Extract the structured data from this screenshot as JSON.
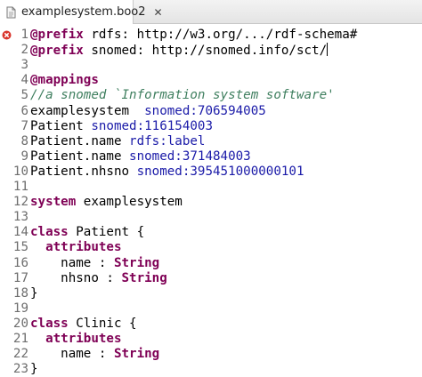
{
  "tab": {
    "title": "examplesystem.boo2",
    "close_glyph": "✕"
  },
  "editor": {
    "lines": [
      {
        "n": "1",
        "marker": "error-icon",
        "tokens": [
          {
            "t": "@prefix",
            "s": "kw"
          },
          {
            "t": " rdfs: http://w3.org/.../rdf-schema#",
            "s": "plain"
          }
        ]
      },
      {
        "n": "2",
        "caret": true,
        "tokens": [
          {
            "t": "@prefix",
            "s": "kw"
          },
          {
            "t": " snomed: http://snomed.info/sct/",
            "s": "plain"
          }
        ]
      },
      {
        "n": "3",
        "tokens": []
      },
      {
        "n": "4",
        "tokens": [
          {
            "t": "@mappings",
            "s": "kw"
          }
        ]
      },
      {
        "n": "5",
        "tokens": [
          {
            "t": "//a snomed `Information system software'",
            "s": "cm"
          }
        ]
      },
      {
        "n": "6",
        "tokens": [
          {
            "t": "examplesystem  ",
            "s": "plain"
          },
          {
            "t": "snomed:706594005",
            "s": "uri"
          }
        ]
      },
      {
        "n": "7",
        "tokens": [
          {
            "t": "Patient ",
            "s": "plain"
          },
          {
            "t": "snomed:116154003",
            "s": "uri"
          }
        ]
      },
      {
        "n": "8",
        "tokens": [
          {
            "t": "Patient.name ",
            "s": "plain"
          },
          {
            "t": "rdfs:label",
            "s": "uri"
          }
        ]
      },
      {
        "n": "9",
        "tokens": [
          {
            "t": "Patient.name ",
            "s": "plain"
          },
          {
            "t": "snomed:371484003",
            "s": "uri"
          }
        ]
      },
      {
        "n": "10",
        "tokens": [
          {
            "t": "Patient.nhsno ",
            "s": "plain"
          },
          {
            "t": "snomed:395451000000101",
            "s": "uri"
          }
        ]
      },
      {
        "n": "11",
        "tokens": []
      },
      {
        "n": "12",
        "tokens": [
          {
            "t": "system",
            "s": "kw"
          },
          {
            "t": " examplesystem",
            "s": "plain"
          }
        ]
      },
      {
        "n": "13",
        "tokens": []
      },
      {
        "n": "14",
        "tokens": [
          {
            "t": "class",
            "s": "kw"
          },
          {
            "t": " Patient {",
            "s": "plain"
          }
        ]
      },
      {
        "n": "15",
        "tokens": [
          {
            "t": "  ",
            "s": "plain"
          },
          {
            "t": "attributes",
            "s": "kw"
          }
        ]
      },
      {
        "n": "16",
        "tokens": [
          {
            "t": "    name : ",
            "s": "plain"
          },
          {
            "t": "String",
            "s": "kw"
          }
        ]
      },
      {
        "n": "17",
        "tokens": [
          {
            "t": "    nhsno : ",
            "s": "plain"
          },
          {
            "t": "String",
            "s": "kw"
          }
        ]
      },
      {
        "n": "18",
        "tokens": [
          {
            "t": "}",
            "s": "plain"
          }
        ]
      },
      {
        "n": "19",
        "tokens": []
      },
      {
        "n": "20",
        "tokens": [
          {
            "t": "class",
            "s": "kw"
          },
          {
            "t": " Clinic {",
            "s": "plain"
          }
        ]
      },
      {
        "n": "21",
        "tokens": [
          {
            "t": "  ",
            "s": "plain"
          },
          {
            "t": "attributes",
            "s": "kw"
          }
        ]
      },
      {
        "n": "22",
        "tokens": [
          {
            "t": "    name : ",
            "s": "plain"
          },
          {
            "t": "String",
            "s": "kw"
          }
        ]
      },
      {
        "n": "23",
        "tokens": [
          {
            "t": "}",
            "s": "plain"
          }
        ]
      }
    ]
  }
}
